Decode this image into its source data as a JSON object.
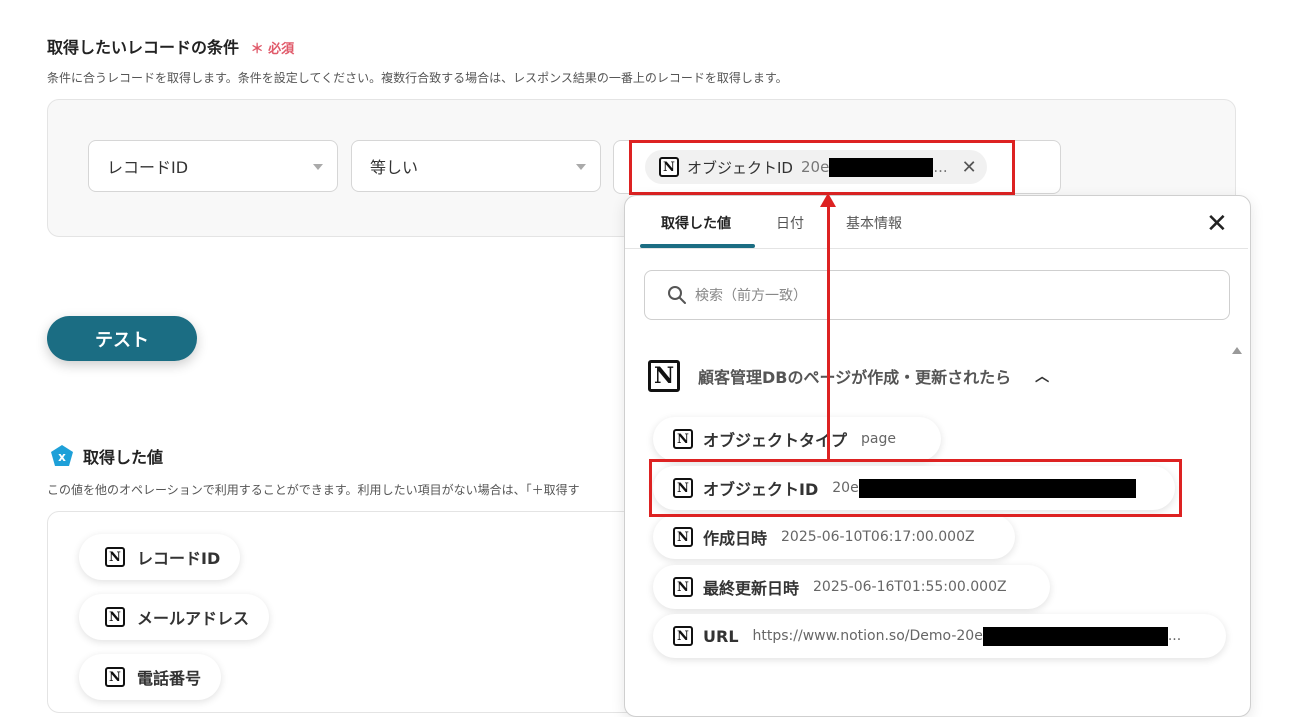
{
  "section": {
    "title": "取得したいレコードの条件",
    "required_mark": "＊",
    "required_label": "必須",
    "description": "条件に合うレコードを取得します。条件を設定してください。複数行合致する場合は、レスポンス結果の一番上のレコードを取得します。"
  },
  "condition": {
    "field_select": "レコードID",
    "operator_select": "等しい",
    "value_chip_label": "オブジェクトID",
    "value_chip_prefix": "20e",
    "value_chip_suffix": "..."
  },
  "test_button": "テスト",
  "got_values": {
    "title": "取得した値",
    "icon_glyph": "x",
    "description": "この値を他のオペレーションで利用することができます。利用したい項目がない場合は、「＋取得す",
    "items": [
      "レコードID",
      "メールアドレス",
      "電話番号"
    ]
  },
  "panel": {
    "tabs": [
      "取得した値",
      "日付",
      "基本情報"
    ],
    "active_tab": 0,
    "search_placeholder": "検索（前方一致）",
    "group_title": "顧客管理DBのページが作成・更新されたら",
    "items": [
      {
        "label": "オブジェクトタイプ",
        "value": "page"
      },
      {
        "label": "オブジェクトID",
        "value": "20e"
      },
      {
        "label": "作成日時",
        "value": "2025-06-10T06:17:00.000Z"
      },
      {
        "label": "最終更新日時",
        "value": "2025-06-16T01:55:00.000Z"
      },
      {
        "label": "URL",
        "value": "https://www.notion.so/Demo-20e",
        "suffix": "..."
      }
    ]
  },
  "icons": {
    "notion_glyph": "N",
    "close_glyph": "✕",
    "chevron_up": "︿"
  },
  "colors": {
    "accent": "#1b6d83",
    "required": "#e05a6a",
    "highlight": "#dd2222",
    "got_icon": "#1ea0d8"
  }
}
